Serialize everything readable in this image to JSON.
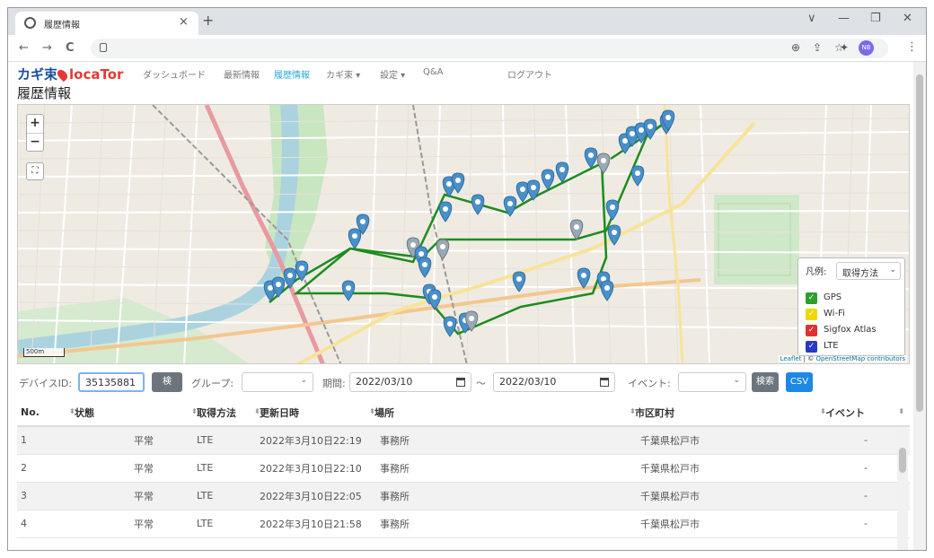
{
  "browser": {
    "tab_title": "履歴情報",
    "tab_close": "×",
    "new_tab": "+",
    "url": "",
    "controls": [
      "∨",
      "—",
      "❐",
      "✕"
    ],
    "nav": {
      "back": "←",
      "forward": "→",
      "reload": "C"
    },
    "profile": "NB"
  },
  "app": {
    "brand_part1": "カギ束",
    "brand_part2": "locaTor",
    "nav": [
      {
        "label": "ダッシュボード",
        "active": false
      },
      {
        "label": "最新情報",
        "active": false
      },
      {
        "label": "履歴情報",
        "active": true
      },
      {
        "label": "カギ束 ▾",
        "active": false
      },
      {
        "label": "設定 ▾",
        "active": false
      },
      {
        "label": "Q&A",
        "active": false
      },
      {
        "label": "ログアウト",
        "active": false
      }
    ],
    "page_title": "履歴情報"
  },
  "map": {
    "zoom_in": "+",
    "zoom_out": "−",
    "fullscreen": "⛶",
    "scale": "500m",
    "attribution_leaflet": "Leaflet",
    "attribution_osm": "OpenStreetMap contributors",
    "legend": {
      "label": "凡例:",
      "select_value": "取得方法",
      "items": [
        {
          "label": "GPS",
          "color": "#2e9e2e"
        },
        {
          "label": "Wi-Fi",
          "color": "#f0d800"
        },
        {
          "label": "Sigfox Atlas",
          "color": "#e03030"
        },
        {
          "label": "LTE",
          "color": "#2838c8"
        }
      ]
    },
    "route_color": "#1e8c1e",
    "pin_color": "#4a90c8"
  },
  "filter": {
    "device_label": "デバイスID:",
    "device_value": "35135881",
    "device_btn": "検",
    "group_label": "グループ:",
    "period_label": "期間:",
    "date_from": "2022/03/10",
    "tilde": "〜",
    "date_to": "2022/03/10",
    "event_label": "イベント:",
    "search_btn": "検索",
    "csv_btn": "CSV"
  },
  "table": {
    "headers": [
      "No.",
      "状態",
      "取得方法",
      "更新日時",
      "場所",
      "市区町村",
      "イベント"
    ],
    "rows": [
      [
        "1",
        "平常",
        "LTE",
        "2022年3月10日22:19",
        "事務所",
        "千葉県松戸市",
        "-"
      ],
      [
        "2",
        "平常",
        "LTE",
        "2022年3月10日22:10",
        "事務所",
        "千葉県松戸市",
        "-"
      ],
      [
        "3",
        "平常",
        "LTE",
        "2022年3月10日22:05",
        "事務所",
        "千葉県松戸市",
        "-"
      ],
      [
        "4",
        "平常",
        "LTE",
        "2022年3月10日21:58",
        "事務所",
        "千葉県松戸市",
        "-"
      ]
    ]
  }
}
